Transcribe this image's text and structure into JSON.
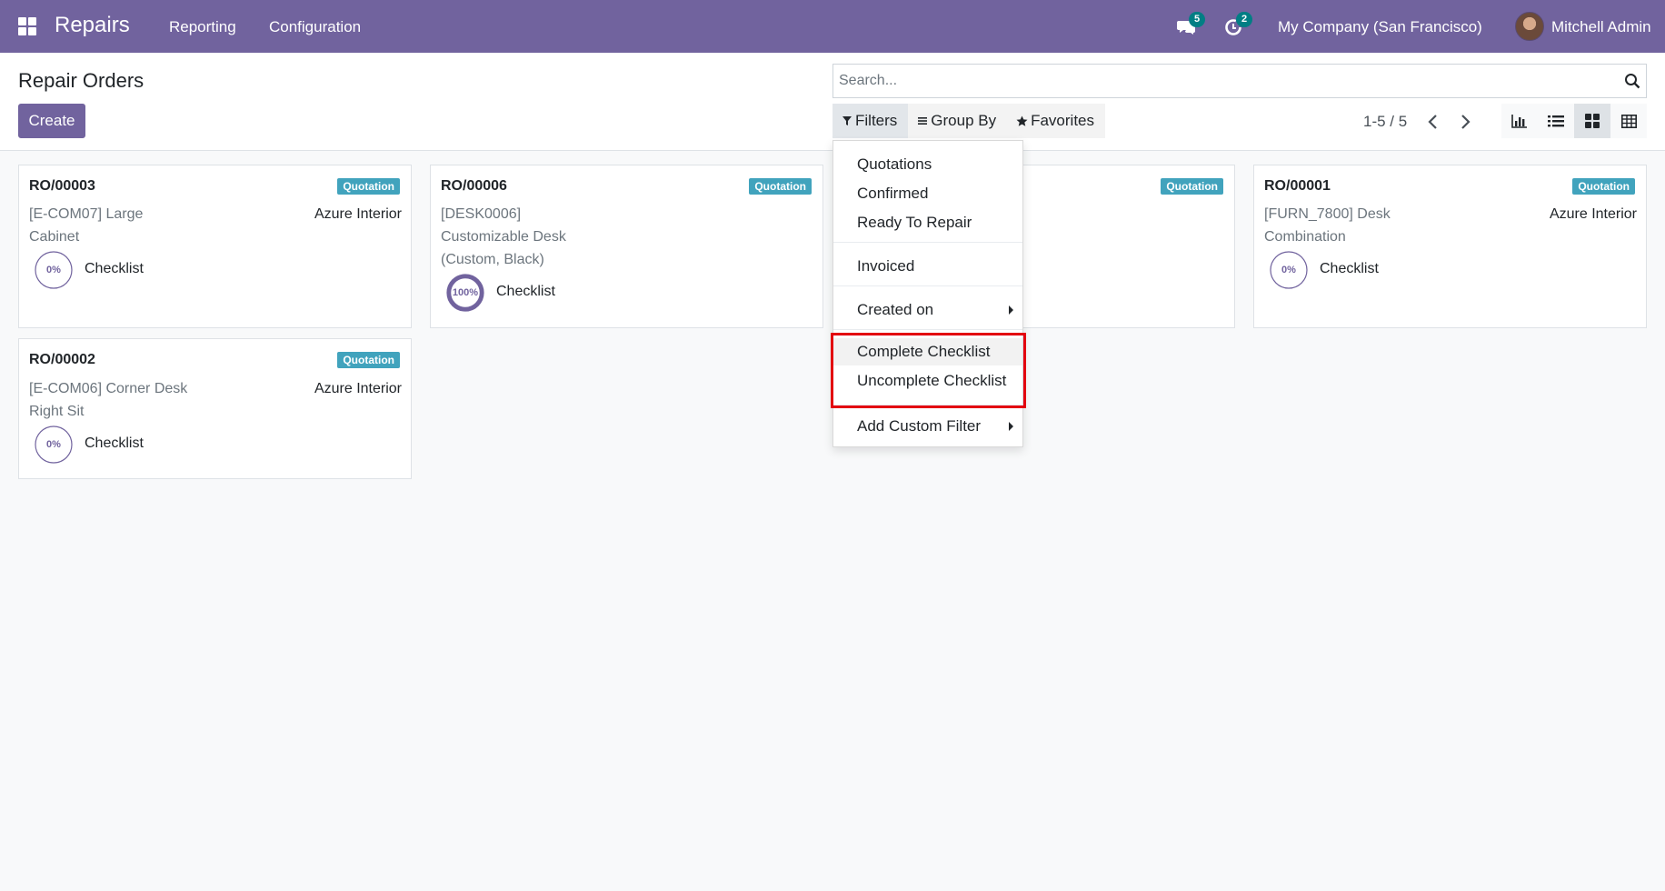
{
  "navbar": {
    "app_name": "Repairs",
    "menu": [
      "Reporting",
      "Configuration"
    ],
    "messages_count": "5",
    "activities_count": "2",
    "company": "My Company (San Francisco)",
    "user": "Mitchell Admin",
    "color": "#71639e"
  },
  "control_panel": {
    "title": "Repair Orders",
    "create_label": "Create",
    "search_placeholder": "Search...",
    "filters_label": "Filters",
    "groupby_label": "Group By",
    "favorites_label": "Favorites",
    "pager": "1-5 / 5",
    "views": [
      "graph-view",
      "list-view",
      "kanban-view",
      "pivot-view"
    ],
    "active_view": "kanban-view"
  },
  "cards": [
    {
      "ref": "RO/00003",
      "status": "Quotation",
      "product_line1": "[E-COM07] Large",
      "product_line2": "Cabinet",
      "product_line3": "",
      "customer": "Azure Interior",
      "progress": 0,
      "progress_label": "0%",
      "checklist_label": "Checklist"
    },
    {
      "ref": "RO/00006",
      "status": "Quotation",
      "product_line1": "[DESK0006]",
      "product_line2": "Customizable Desk",
      "product_line3": "(Custom, Black)",
      "customer": "",
      "progress": 100,
      "progress_label": "100%",
      "checklist_label": "Checklist"
    },
    {
      "ref": "",
      "status": "Quotation",
      "product_line1": "",
      "product_line2": "",
      "product_line3": "",
      "customer": "",
      "progress": null,
      "progress_label": "",
      "checklist_label": ""
    },
    {
      "ref": "RO/00001",
      "status": "Quotation",
      "product_line1": "[FURN_7800] Desk",
      "product_line2": "Combination",
      "product_line3": "",
      "customer": "Azure Interior",
      "progress": 0,
      "progress_label": "0%",
      "checklist_label": "Checklist"
    },
    {
      "ref": "RO/00002",
      "status": "Quotation",
      "product_line1": "[E-COM06] Corner Desk",
      "product_line2": "Right Sit",
      "product_line3": "",
      "customer": "Azure Interior",
      "progress": 0,
      "progress_label": "0%",
      "checklist_label": "Checklist"
    }
  ],
  "filters_menu": {
    "group1": [
      "Quotations",
      "Confirmed",
      "Ready To Repair"
    ],
    "group2": [
      "Invoiced"
    ],
    "group3": [
      "Created on"
    ],
    "group4": [
      "Complete Checklist",
      "Uncomplete Checklist"
    ],
    "group5": [
      "Add Custom Filter"
    ],
    "hovered": "Complete Checklist"
  },
  "colors": {
    "badge": "#41a3bd",
    "notification_badge": "#017e84",
    "highlight": "#e3000f"
  }
}
